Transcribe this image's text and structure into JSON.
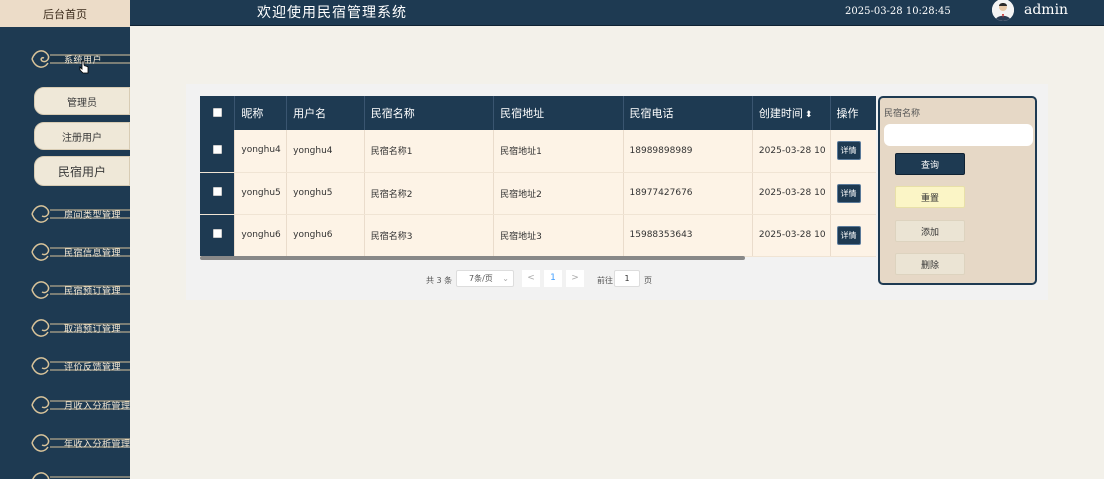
{
  "sidebar": {
    "home_label": "后台首页",
    "menu": [
      {
        "label": "系统用户"
      },
      {
        "label": "房间类型管理"
      },
      {
        "label": "民宿信息管理"
      },
      {
        "label": "民宿预订管理"
      },
      {
        "label": "取消预订管理"
      },
      {
        "label": "评价反馈管理"
      },
      {
        "label": "月收入分析管理"
      },
      {
        "label": "年收入分析管理"
      }
    ],
    "submenu": [
      {
        "label": "管理员"
      },
      {
        "label": "注册用户"
      },
      {
        "label": "民宿用户"
      }
    ]
  },
  "header": {
    "title": "欢迎使用民宿管理系统",
    "datetime": "2025-03-28 10:28:45",
    "username": "admin"
  },
  "table": {
    "columns": [
      "昵称",
      "用户名",
      "民宿名称",
      "民宿地址",
      "民宿电话",
      "创建时间",
      "操作"
    ],
    "rows": [
      {
        "nickname": "yonghu4",
        "username": "yonghu4",
        "name": "民宿名称1",
        "address": "民宿地址1",
        "phone": "18989898989",
        "created": "2025-03-28 10",
        "action": "详情"
      },
      {
        "nickname": "yonghu5",
        "username": "yonghu5",
        "name": "民宿名称2",
        "address": "民宿地址2",
        "phone": "18977427676",
        "created": "2025-03-28 10",
        "action": "详情"
      },
      {
        "nickname": "yonghu6",
        "username": "yonghu6",
        "name": "民宿名称3",
        "address": "民宿地址3",
        "phone": "15988353643",
        "created": "2025-03-28 10",
        "action": "详情"
      }
    ]
  },
  "pagination": {
    "total": "共 3 条",
    "page_size": "7条/页",
    "prev": "<",
    "current_page": "1",
    "next": ">",
    "goto_label": "前往",
    "goto_value": "1",
    "goto_unit": "页"
  },
  "search": {
    "label": "民宿名称",
    "query_label": "查询",
    "reset_label": "重置",
    "add_label": "添加",
    "delete_label": "删除"
  },
  "colors": {
    "primary": "#1e3a52",
    "sidebar_accent": "#ecdcc8",
    "row_bg": "#fdf3e6",
    "reset_bg": "#fbf5c6"
  }
}
